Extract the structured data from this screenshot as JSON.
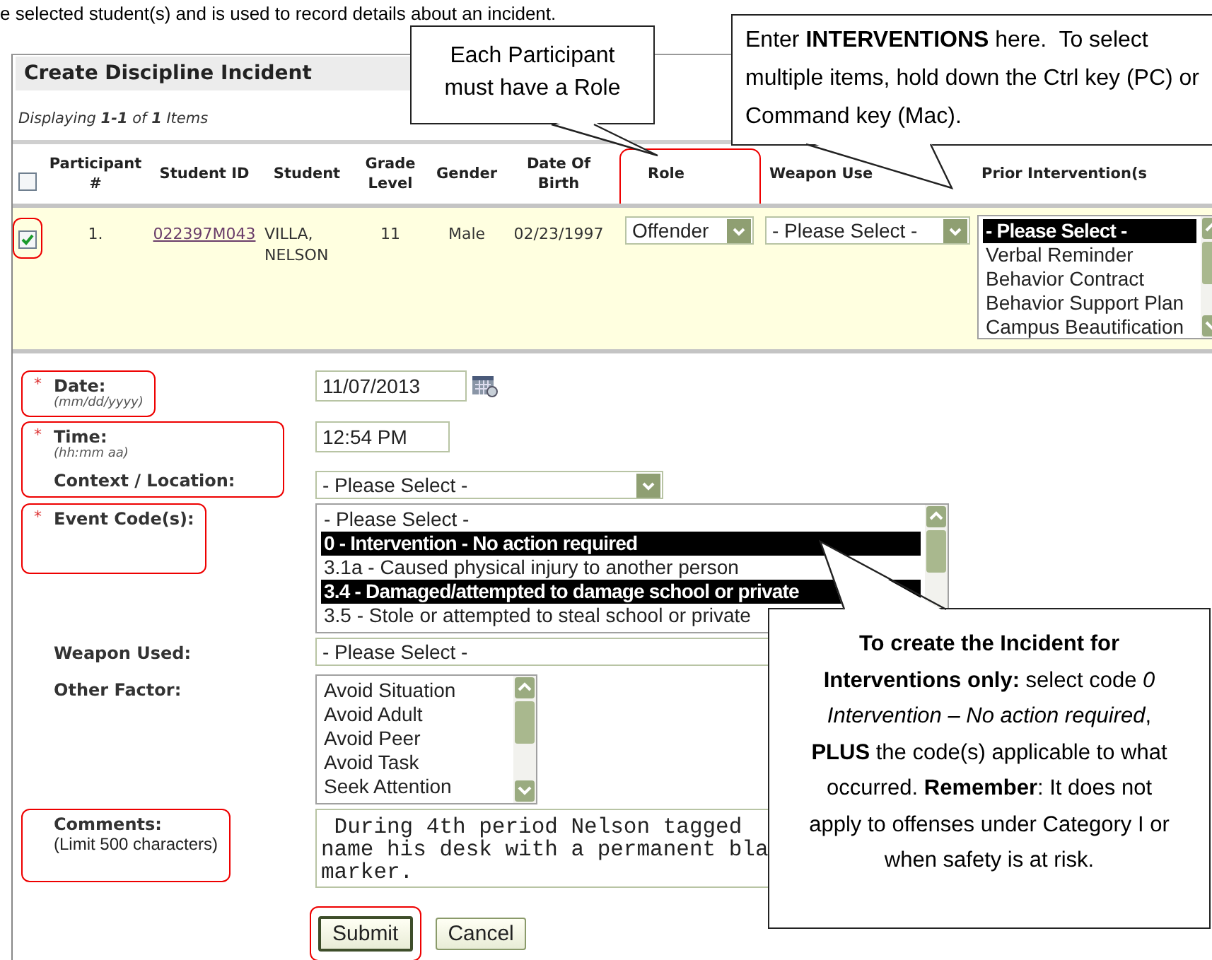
{
  "intro_line": "e selected student(s) and is used to record details about an incident.",
  "panel": {
    "title": "Create Discipline Incident",
    "paging": "Displaying **1-1** of **1** Items",
    "select_all_checked": false,
    "columns": [
      {
        "label": "Participant #",
        "outlined": false
      },
      {
        "label": "Student ID",
        "outlined": false
      },
      {
        "label": "Student",
        "outlined": false
      },
      {
        "label": "Grade Level",
        "outlined": false
      },
      {
        "label": "Gender",
        "outlined": false
      },
      {
        "label": "Date Of Birth",
        "outlined": false
      },
      {
        "label": "Role",
        "outlined": true
      },
      {
        "label": "Weapon Use",
        "outlined": false
      },
      {
        "label": "Prior Intervention(s",
        "outlined": false
      }
    ],
    "participants": [
      {
        "checked": true,
        "outlined": true,
        "number": "1.",
        "student_id": "022397M043",
        "student": "VILLA, NELSON",
        "grade": "11",
        "gender": "Male",
        "dob": "02/23/1997",
        "role": "Offender",
        "weapon": "- Please Select -",
        "prior_interventions": [
          {
            "label": "- Please Select -",
            "selected": true
          },
          {
            "label": "Verbal Reminder",
            "selected": false
          },
          {
            "label": "Behavior Contract",
            "selected": false
          },
          {
            "label": "Behavior Support Plan",
            "selected": false
          },
          {
            "label": "Campus Beautification",
            "selected": false
          }
        ]
      }
    ]
  },
  "form": {
    "fields": [
      {
        "kind": "date",
        "marker": "*",
        "label": "Date:",
        "hint": "(mm/dd/yyyy)",
        "outlined": true,
        "outline_joins_next": false,
        "value": "11/07/2013"
      },
      {
        "kind": "text",
        "marker": "*",
        "label": "Time:",
        "hint": "(hh:mm aa)",
        "outlined": true,
        "outline_joins_next": true,
        "value": "12:54 PM"
      },
      {
        "kind": "select",
        "label": "Context / Location:",
        "outlined": true,
        "outline_joins_next": false,
        "value": "- Please Select -"
      },
      {
        "kind": "wide_listbox",
        "marker": "*",
        "label": "Event Code(s):",
        "outlined": true,
        "outline_joins_next": false,
        "options": [
          {
            "label": "- Please Select -",
            "selected": false
          },
          {
            "label": "0 - Intervention - No action required",
            "selected": true
          },
          {
            "label": "3.1a - Caused physical injury to another person",
            "selected": false
          },
          {
            "label": "3.4 - Damaged/attempted to damage school or private",
            "selected": true
          },
          {
            "label": "3.5 - Stole or attempted to steal school or private",
            "selected": false
          }
        ]
      },
      {
        "kind": "wide_select",
        "label": "Weapon Used:",
        "outlined": false,
        "value": "- Please Select -"
      },
      {
        "kind": "listbox",
        "label": "Other Factor:",
        "outlined": false,
        "options": [
          {
            "label": "Avoid Situation",
            "selected": false
          },
          {
            "label": "Avoid Adult",
            "selected": false
          },
          {
            "label": "Avoid Peer",
            "selected": false
          },
          {
            "label": "Avoid Task",
            "selected": false
          },
          {
            "label": "Seek Attention",
            "selected": false
          }
        ]
      },
      {
        "kind": "textarea",
        "label": "Comments:",
        "hint": "(Limit 500 characters)",
        "outlined": true,
        "outline_joins_next": false,
        "value": " During 4th period Nelson tagged\nname his desk with a permanent bla\nmarker."
      }
    ],
    "buttons": [
      {
        "label": "Submit",
        "outlined": true
      },
      {
        "label": "Cancel",
        "outlined": false
      }
    ]
  },
  "callouts": [
    {
      "kind": "role",
      "text": "Each Participant must have a Role"
    },
    {
      "kind": "interventions",
      "text": "Enter **INTERVENTIONS** here.  To select multiple items, hold down the Ctrl key (PC) or Command key (Mac)."
    },
    {
      "kind": "codes",
      "text": "**To create the Incident for Interventions only:**  select code *0 Intervention – No action required*, **PLUS** the code(s) applicable to what occurred. **Remember**:  It does not apply to offenses under Category I or when safety is at risk."
    }
  ]
}
